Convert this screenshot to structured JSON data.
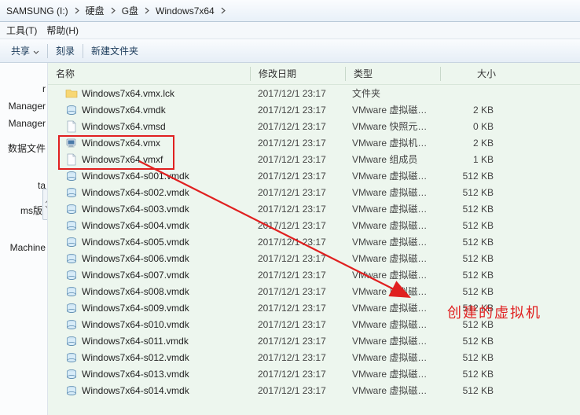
{
  "breadcrumb": [
    {
      "label": "SAMSUNG (I:)"
    },
    {
      "label": "硬盘"
    },
    {
      "label": "G盘"
    },
    {
      "label": "Windows7x64"
    }
  ],
  "menu": {
    "tools": "工具(T)",
    "help": "帮助(H)"
  },
  "toolbar": {
    "share": "共享",
    "burn": "刻录",
    "newfolder": "新建文件夹"
  },
  "nav_items": [
    "r",
    "Manager",
    "Manager",
    "",
    "数据文件",
    "",
    "",
    "",
    "ta",
    "",
    "ms版)",
    "",
    "",
    "",
    "Machine"
  ],
  "columns": {
    "name": "名称",
    "date": "修改日期",
    "type": "类型",
    "size": "大小"
  },
  "files": [
    {
      "icon": "folder",
      "name": "Windows7x64.vmx.lck",
      "date": "2017/12/1 23:17",
      "type": "文件夹",
      "size": ""
    },
    {
      "icon": "vmdk",
      "name": "Windows7x64.vmdk",
      "date": "2017/12/1 23:17",
      "type": "VMware 虚拟磁盘...",
      "size": "2 KB"
    },
    {
      "icon": "file",
      "name": "Windows7x64.vmsd",
      "date": "2017/12/1 23:17",
      "type": "VMware 快照元数据",
      "size": "0 KB"
    },
    {
      "icon": "vmx",
      "name": "Windows7x64.vmx",
      "date": "2017/12/1 23:17",
      "type": "VMware 虚拟机配置",
      "size": "2 KB"
    },
    {
      "icon": "file",
      "name": "Windows7x64.vmxf",
      "date": "2017/12/1 23:17",
      "type": "VMware 组成员",
      "size": "1 KB"
    },
    {
      "icon": "vmdk",
      "name": "Windows7x64-s001.vmdk",
      "date": "2017/12/1 23:17",
      "type": "VMware 虚拟磁盘...",
      "size": "512 KB"
    },
    {
      "icon": "vmdk",
      "name": "Windows7x64-s002.vmdk",
      "date": "2017/12/1 23:17",
      "type": "VMware 虚拟磁盘...",
      "size": "512 KB"
    },
    {
      "icon": "vmdk",
      "name": "Windows7x64-s003.vmdk",
      "date": "2017/12/1 23:17",
      "type": "VMware 虚拟磁盘...",
      "size": "512 KB"
    },
    {
      "icon": "vmdk",
      "name": "Windows7x64-s004.vmdk",
      "date": "2017/12/1 23:17",
      "type": "VMware 虚拟磁盘...",
      "size": "512 KB"
    },
    {
      "icon": "vmdk",
      "name": "Windows7x64-s005.vmdk",
      "date": "2017/12/1 23:17",
      "type": "VMware 虚拟磁盘...",
      "size": "512 KB"
    },
    {
      "icon": "vmdk",
      "name": "Windows7x64-s006.vmdk",
      "date": "2017/12/1 23:17",
      "type": "VMware 虚拟磁盘...",
      "size": "512 KB"
    },
    {
      "icon": "vmdk",
      "name": "Windows7x64-s007.vmdk",
      "date": "2017/12/1 23:17",
      "type": "VMware 虚拟磁盘...",
      "size": "512 KB"
    },
    {
      "icon": "vmdk",
      "name": "Windows7x64-s008.vmdk",
      "date": "2017/12/1 23:17",
      "type": "VMware 虚拟磁盘...",
      "size": "512 KB"
    },
    {
      "icon": "vmdk",
      "name": "Windows7x64-s009.vmdk",
      "date": "2017/12/1 23:17",
      "type": "VMware 虚拟磁盘...",
      "size": "512 KB"
    },
    {
      "icon": "vmdk",
      "name": "Windows7x64-s010.vmdk",
      "date": "2017/12/1 23:17",
      "type": "VMware 虚拟磁盘...",
      "size": "512 KB"
    },
    {
      "icon": "vmdk",
      "name": "Windows7x64-s011.vmdk",
      "date": "2017/12/1 23:17",
      "type": "VMware 虚拟磁盘...",
      "size": "512 KB"
    },
    {
      "icon": "vmdk",
      "name": "Windows7x64-s012.vmdk",
      "date": "2017/12/1 23:17",
      "type": "VMware 虚拟磁盘...",
      "size": "512 KB"
    },
    {
      "icon": "vmdk",
      "name": "Windows7x64-s013.vmdk",
      "date": "2017/12/1 23:17",
      "type": "VMware 虚拟磁盘...",
      "size": "512 KB"
    },
    {
      "icon": "vmdk",
      "name": "Windows7x64-s014.vmdk",
      "date": "2017/12/1 23:17",
      "type": "VMware 虚拟磁盘...",
      "size": "512 KB"
    }
  ],
  "annotation_text": "创建的虚拟机"
}
